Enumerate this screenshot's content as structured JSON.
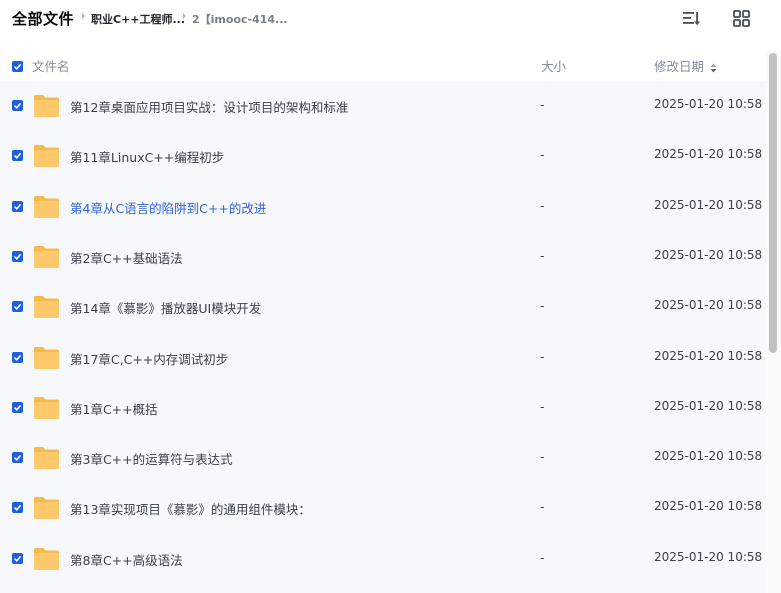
{
  "breadcrumb": {
    "root": "全部文件",
    "items": [
      "职业C++工程师...",
      "2【imooc-414..."
    ]
  },
  "toolbar": {
    "sort_icon": "sort-list-icon",
    "view_icon": "grid-view-icon"
  },
  "columns": {
    "name": "文件名",
    "size": "大小",
    "date": "修改日期"
  },
  "colors": {
    "accent": "#1d5fe0",
    "link": "#2f63e0",
    "folder": "#fdc96b",
    "row_bg": "#f7f8fc"
  },
  "files": [
    {
      "name": "第12章桌面应用项目实战：设计项目的架构和标准",
      "size": "-",
      "date": "2025-01-20 10:58"
    },
    {
      "name": "第11章LinuxC++编程初步",
      "size": "-",
      "date": "2025-01-20 10:58"
    },
    {
      "name": "第4章从C语言的陷阱到C++的改进",
      "size": "-",
      "date": "2025-01-20 10:58"
    },
    {
      "name": "第2章C++基础语法",
      "size": "-",
      "date": "2025-01-20 10:58"
    },
    {
      "name": "第14章《慕影》播放器UI模块开发",
      "size": "-",
      "date": "2025-01-20 10:58"
    },
    {
      "name": "第17章C,C++内存调试初步",
      "size": "-",
      "date": "2025-01-20 10:58"
    },
    {
      "name": "第1章C++概括",
      "size": "-",
      "date": "2025-01-20 10:58"
    },
    {
      "name": "第3章C++的运算符与表达式",
      "size": "-",
      "date": "2025-01-20 10:58"
    },
    {
      "name": "第13章实现项目《慕影》的通用组件模块：",
      "size": "-",
      "date": "2025-01-20 10:58"
    },
    {
      "name": "第8章C++高级语法",
      "size": "-",
      "date": "2025-01-20 10:58"
    }
  ]
}
